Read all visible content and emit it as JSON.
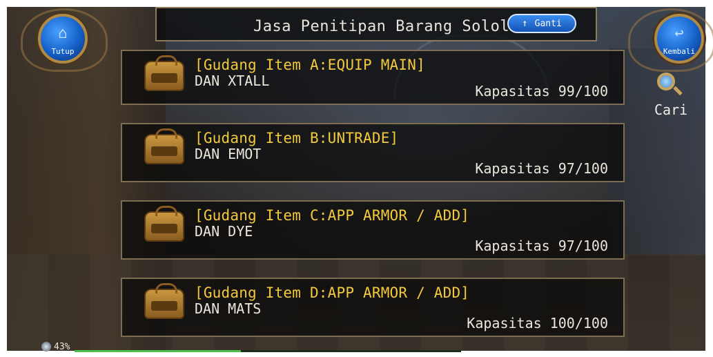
{
  "header": {
    "title": "Jasa Penitipan Barang Sololo",
    "switch_label": "Ganti",
    "close_label": "Tutup",
    "back_label": "Kembali",
    "search_label": "Cari"
  },
  "storage_items": [
    {
      "title": "[Gudang Item A:EQUIP MAIN]",
      "subtitle": "DAN XTALL",
      "capacity": "Kapasitas 99/100"
    },
    {
      "title": "[Gudang Item B:UNTRADE]",
      "subtitle": "DAN EMOT",
      "capacity": "Kapasitas 97/100"
    },
    {
      "title": "[Gudang Item C:APP ARMOR / ADD]",
      "subtitle": "DAN DYE",
      "capacity": "Kapasitas 97/100"
    },
    {
      "title": "[Gudang Item D:APP ARMOR / ADD]",
      "subtitle": "DAN MATS",
      "capacity": "Kapasitas 100/100"
    }
  ],
  "status": {
    "percent_label": "43%",
    "progress": 0.43
  },
  "colors": {
    "title_gold": "#f3c93d",
    "button_blue": "#1560c8",
    "frame_bronze": "#8b7a5c"
  }
}
